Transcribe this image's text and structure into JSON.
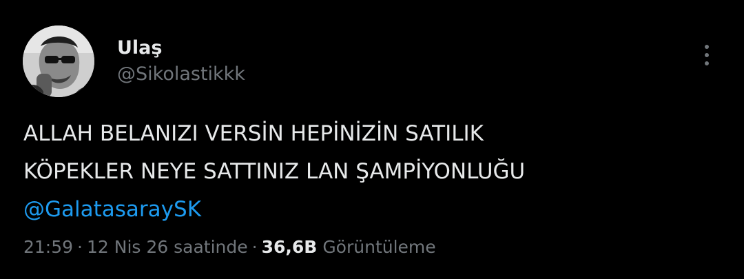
{
  "tweet": {
    "author": {
      "display_name": "Ulaş",
      "handle": "@Sikolastikkk",
      "avatar": "grayscale-photo-man-with-sunglasses-smoking"
    },
    "more_icon": "more-vertical-icon",
    "text_lines": [
      "ALLAH BELANIZI VERSİN HEPİNİZİN SATILIK",
      "KÖPEKLER NEYE SATTINIZ LAN ŞAMPİYONLUĞU"
    ],
    "mention": "@GalatasaraySK",
    "meta": {
      "time": "21:59",
      "separator": "·",
      "relative_date": "12 Nis 26 saatinde",
      "views_count": "36,6B",
      "views_label": "Görüntüleme"
    }
  },
  "colors": {
    "background": "#000000",
    "primary_text": "#e7e9ea",
    "secondary_text": "#71767b",
    "link": "#1d9bf0"
  }
}
